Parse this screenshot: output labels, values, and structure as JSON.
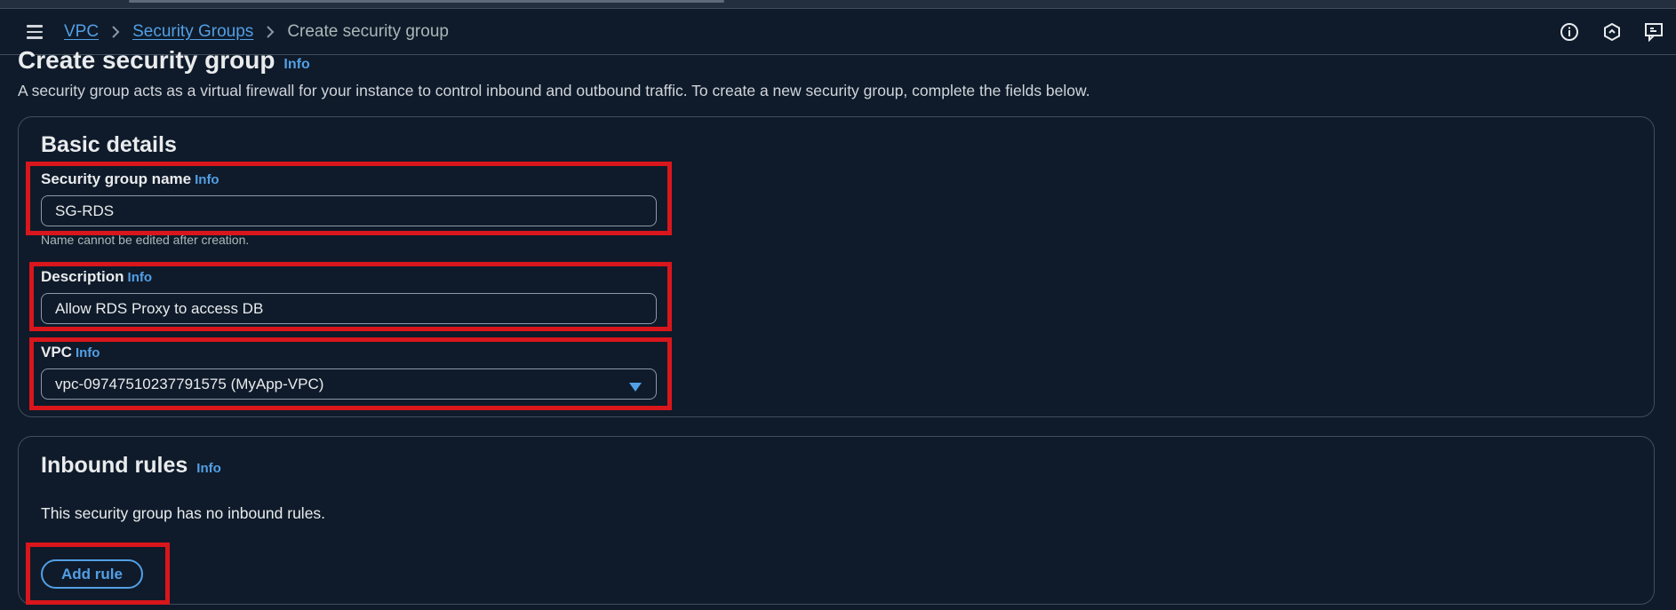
{
  "breadcrumb": {
    "items": [
      "VPC",
      "Security Groups"
    ],
    "current": "Create security group"
  },
  "header_icons": [
    "info-circle-icon",
    "settings-hexagon-icon",
    "feedback-icon"
  ],
  "page": {
    "title": "Create security group",
    "info": "Info",
    "description": "A security group acts as a virtual firewall for your instance to control inbound and outbound traffic. To create a new security group, complete the fields below."
  },
  "basic_details": {
    "heading": "Basic details",
    "name_field": {
      "label": "Security group name",
      "info": "Info",
      "value": "SG-RDS",
      "constraint": "Name cannot be edited after creation."
    },
    "description_field": {
      "label": "Description",
      "info": "Info",
      "value": "Allow RDS Proxy to access DB"
    },
    "vpc_field": {
      "label": "VPC",
      "info": "Info",
      "value": "vpc-09747510237791575 (MyApp-VPC)"
    }
  },
  "inbound_rules": {
    "heading": "Inbound rules",
    "info": "Info",
    "empty_text": "This security group has no inbound rules.",
    "add_rule_label": "Add rule"
  },
  "colors": {
    "background": "#0f1b2a",
    "link": "#539fe5",
    "highlight": "#d9161c",
    "border": "#414d5c"
  }
}
